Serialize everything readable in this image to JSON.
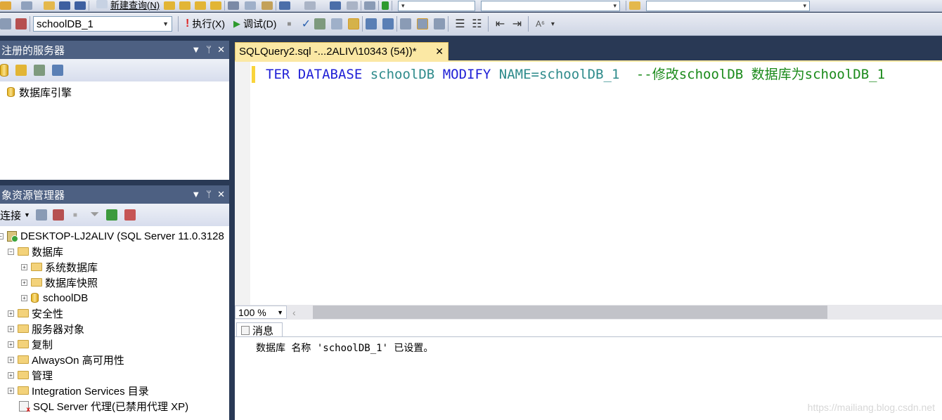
{
  "toolbar1": {
    "new_query_label": "新建查询(N)"
  },
  "toolbar2": {
    "database_combo_value": "schoolDB_1",
    "execute_label": "执行(X)",
    "debug_label": "调试(D)"
  },
  "registered_servers": {
    "title": "注册的服务器",
    "tree": [
      {
        "label": "数据库引擎"
      }
    ]
  },
  "object_explorer": {
    "title": "象资源管理器",
    "connect_label": "连接",
    "tree": [
      {
        "label": "DESKTOP-LJ2ALIV (SQL Server 11.0.3128",
        "expander": "−"
      },
      {
        "label": "数据库",
        "expander": "−"
      },
      {
        "label": "系统数据库",
        "expander": "+"
      },
      {
        "label": "数据库快照",
        "expander": "+"
      },
      {
        "label": "schoolDB",
        "expander": "+"
      },
      {
        "label": "安全性",
        "expander": "+"
      },
      {
        "label": "服务器对象",
        "expander": "+"
      },
      {
        "label": "复制",
        "expander": "+"
      },
      {
        "label": "AlwaysOn 高可用性",
        "expander": "+"
      },
      {
        "label": "管理",
        "expander": "+"
      },
      {
        "label": "Integration Services 目录",
        "expander": "+"
      },
      {
        "label": "SQL Server 代理(已禁用代理 XP)",
        "expander": ""
      }
    ]
  },
  "editor": {
    "tab_title": "SQLQuery2.sql -...2ALIV\\10343 (54))*",
    "code": {
      "part_keyword1": "ΤER DATABASE",
      "part_ident1": "schoolDB",
      "part_keyword2": "MODIFY",
      "part_ident2": "NAME=schoolDB_1",
      "part_comment": "--修改schoolDB 数据库为schoolDB_1"
    },
    "zoom": "100 %"
  },
  "results": {
    "messages_tab_label": "消息",
    "message_text": "数据库 名称 'schoolDB_1' 已设置。"
  },
  "watermark": "https://mailiang.blog.csdn.net",
  "colors": {
    "chrome": "#293955",
    "panel_header": "#4d6082",
    "active_tab": "#fbe8a4",
    "keyword": "#1f1fd6",
    "identifier": "#2e8b8b",
    "comment": "#1a8a1a"
  }
}
